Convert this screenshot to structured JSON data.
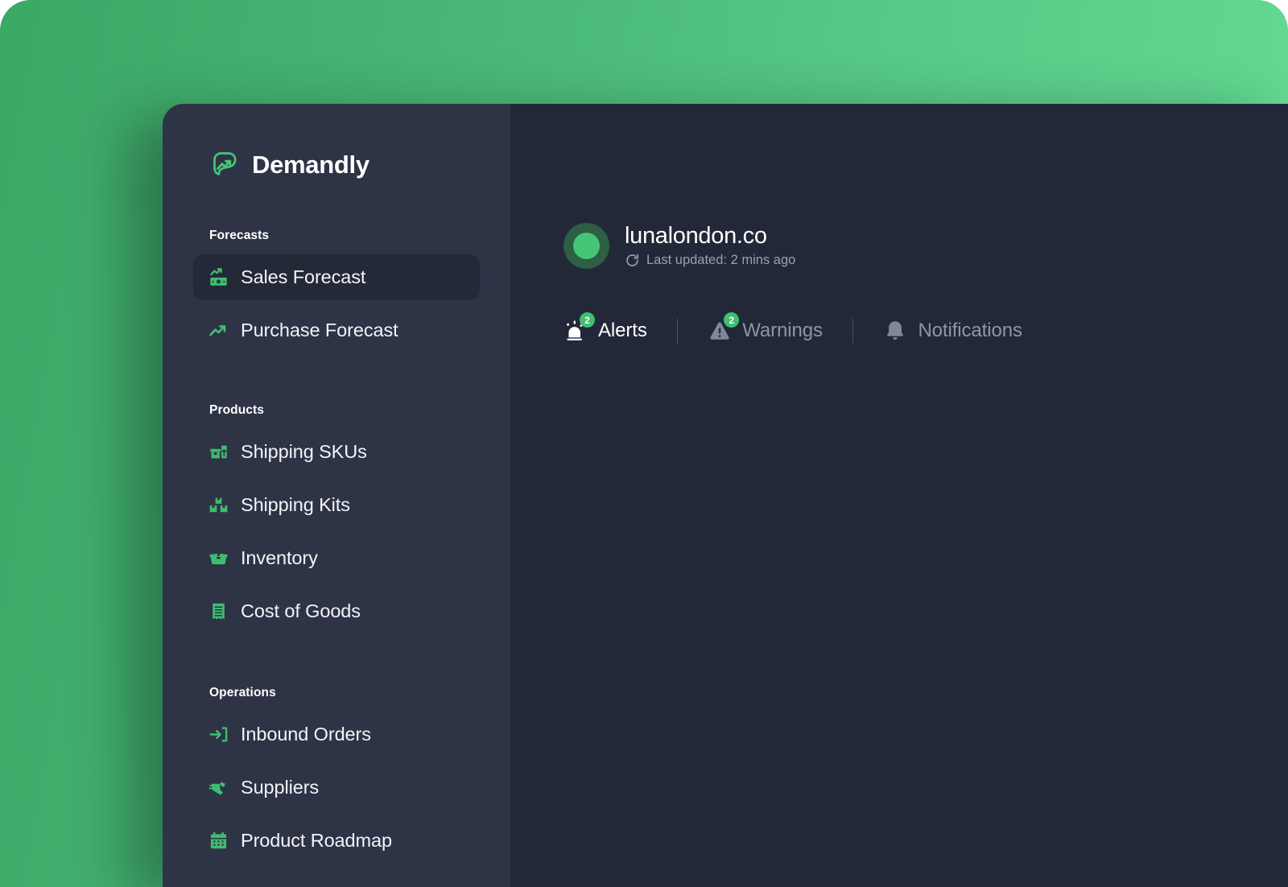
{
  "brand": {
    "name": "Demandly",
    "logo_icon": "trending-up-in-rounded-square-icon",
    "accent": "#45c578"
  },
  "sidebar": {
    "sections": [
      {
        "label": "Forecasts",
        "items": [
          {
            "label": "Sales Forecast",
            "icon": "money-trending-up-icon",
            "active": true
          },
          {
            "label": "Purchase Forecast",
            "icon": "trending-up-icon",
            "active": false
          }
        ]
      },
      {
        "label": "Products",
        "items": [
          {
            "label": "Shipping SKUs",
            "icon": "box-arrow-up-icon",
            "active": false
          },
          {
            "label": "Shipping Kits",
            "icon": "stacked-boxes-icon",
            "active": false
          },
          {
            "label": "Inventory",
            "icon": "open-box-icon",
            "active": false
          },
          {
            "label": "Cost of Goods",
            "icon": "receipt-icon",
            "active": false
          }
        ]
      },
      {
        "label": "Operations",
        "items": [
          {
            "label": "Inbound Orders",
            "icon": "arrow-into-bracket-icon",
            "active": false
          },
          {
            "label": "Suppliers",
            "icon": "delivery-truck-icon",
            "active": false
          },
          {
            "label": "Product Roadmap",
            "icon": "calendar-icon",
            "active": false
          }
        ]
      }
    ]
  },
  "main": {
    "account": {
      "domain": "lunalondon.co",
      "status_color": "#45c578",
      "refresh_icon": "refresh-icon",
      "last_updated": "Last updated: 2 mins ago"
    },
    "tabs": [
      {
        "label": "Alerts",
        "icon": "siren-icon",
        "badge": "2",
        "active": true
      },
      {
        "label": "Warnings",
        "icon": "warning-triangle-icon",
        "badge": "2",
        "active": false
      },
      {
        "label": "Notifications",
        "icon": "bell-icon",
        "badge": "",
        "active": false
      }
    ]
  }
}
